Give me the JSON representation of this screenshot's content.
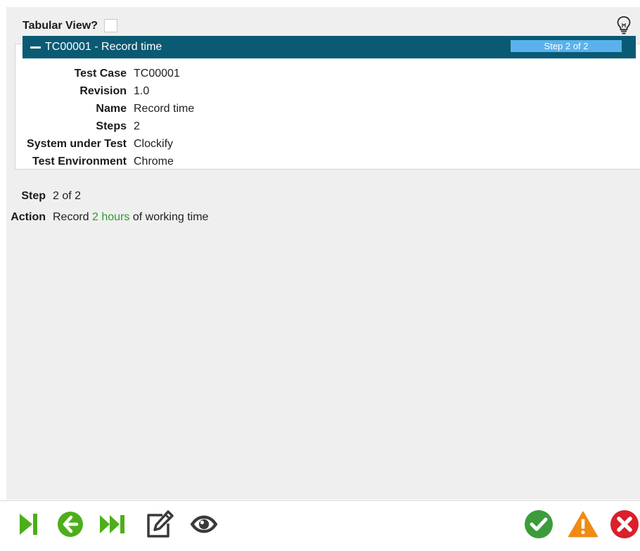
{
  "header": {
    "tabular_label": "Tabular View?",
    "tabular_checked": false
  },
  "card": {
    "title": "TC00001 - Record time",
    "step_badge": "Step 2 of 2",
    "header_color": "#0a5a74",
    "badge_color": "#5ab1ec",
    "fields": [
      {
        "label": "Test Case",
        "value": "TC00001"
      },
      {
        "label": "Revision",
        "value": "1.0"
      },
      {
        "label": "Name",
        "value": "Record time"
      },
      {
        "label": "Steps",
        "value": "2"
      },
      {
        "label": "System under Test",
        "value": "Clockify"
      },
      {
        "label": "Test Environment",
        "value": "Chrome"
      }
    ]
  },
  "step": {
    "step_label": "Step",
    "step_value": "2 of 2",
    "action_label": "Action",
    "action_prefix": "Record",
    "action_highlight": "2 hours",
    "action_suffix": "of working time",
    "highlight_color": "#2f9a2f"
  },
  "toolbar": {
    "left_icons": [
      "skip-to-end-icon",
      "back-arrow-icon",
      "fast-forward-icon",
      "edit-icon",
      "eye-icon"
    ],
    "right_icons": [
      "pass-check-icon",
      "warning-icon",
      "fail-x-icon"
    ],
    "colors": {
      "green": "#4caf1a",
      "dark": "#3a3a3a",
      "pass": "#3c9c3c",
      "warn": "#f08a12",
      "fail": "#d9202c"
    }
  }
}
